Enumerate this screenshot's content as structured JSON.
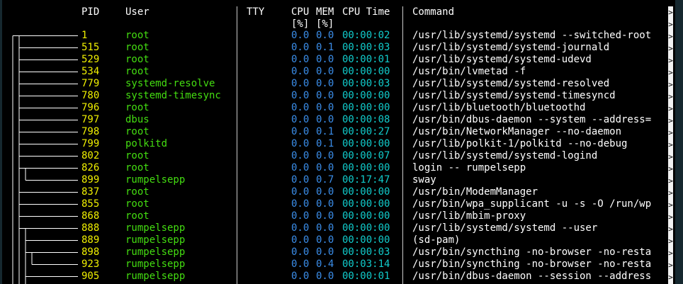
{
  "columns": {
    "pid": "PID",
    "user": "User",
    "tty": "TTY",
    "cpu": "CPU",
    "cpu_unit": "[%]",
    "mem": "MEM",
    "mem_unit": "[%]",
    "cpu_time": "CPU Time",
    "command": "Command"
  },
  "overflow_marker": ">",
  "processes": [
    {
      "pid": "1",
      "user": "root",
      "cpu": "0.0",
      "mem": "0.0",
      "time": "00:00:02",
      "command": "/usr/lib/systemd/systemd --switched-root",
      "depth": 0
    },
    {
      "pid": "515",
      "user": "root",
      "cpu": "0.0",
      "mem": "0.1",
      "time": "00:00:03",
      "command": "/usr/lib/systemd/systemd-journald",
      "depth": 1
    },
    {
      "pid": "529",
      "user": "root",
      "cpu": "0.0",
      "mem": "0.0",
      "time": "00:00:01",
      "command": "/usr/lib/systemd/systemd-udevd",
      "depth": 1
    },
    {
      "pid": "534",
      "user": "root",
      "cpu": "0.0",
      "mem": "0.0",
      "time": "00:00:00",
      "command": "/usr/bin/lvmetad -f",
      "depth": 1
    },
    {
      "pid": "779",
      "user": "systemd-resolve",
      "cpu": "0.0",
      "mem": "0.0",
      "time": "00:00:03",
      "command": "/usr/lib/systemd/systemd-resolved",
      "depth": 1
    },
    {
      "pid": "780",
      "user": "systemd-timesync",
      "cpu": "0.0",
      "mem": "0.0",
      "time": "00:00:00",
      "command": "/usr/lib/systemd/systemd-timesyncd",
      "depth": 1
    },
    {
      "pid": "796",
      "user": "root",
      "cpu": "0.0",
      "mem": "0.0",
      "time": "00:00:00",
      "command": "/usr/lib/bluetooth/bluetoothd",
      "depth": 1
    },
    {
      "pid": "797",
      "user": "dbus",
      "cpu": "0.0",
      "mem": "0.0",
      "time": "00:00:08",
      "command": "/usr/bin/dbus-daemon --system --address=",
      "depth": 1
    },
    {
      "pid": "798",
      "user": "root",
      "cpu": "0.0",
      "mem": "0.1",
      "time": "00:00:27",
      "command": "/usr/bin/NetworkManager --no-daemon",
      "depth": 1
    },
    {
      "pid": "799",
      "user": "polkitd",
      "cpu": "0.0",
      "mem": "0.1",
      "time": "00:00:00",
      "command": "/usr/lib/polkit-1/polkitd --no-debug",
      "depth": 1
    },
    {
      "pid": "802",
      "user": "root",
      "cpu": "0.0",
      "mem": "0.0",
      "time": "00:00:07",
      "command": "/usr/lib/systemd/systemd-logind",
      "depth": 1
    },
    {
      "pid": "826",
      "user": "root",
      "cpu": "0.0",
      "mem": "0.0",
      "time": "00:00:00",
      "command": "login -- rumpelsepp",
      "depth": 1
    },
    {
      "pid": "899",
      "user": "rumpelsepp",
      "cpu": "0.0",
      "mem": "0.7",
      "time": "00:17:47",
      "command": "sway",
      "depth": 2
    },
    {
      "pid": "837",
      "user": "root",
      "cpu": "0.0",
      "mem": "0.0",
      "time": "00:00:00",
      "command": "/usr/bin/ModemManager",
      "depth": 1
    },
    {
      "pid": "855",
      "user": "root",
      "cpu": "0.0",
      "mem": "0.0",
      "time": "00:00:00",
      "command": "/usr/bin/wpa_supplicant -u -s -O /run/wp",
      "depth": 1
    },
    {
      "pid": "868",
      "user": "root",
      "cpu": "0.0",
      "mem": "0.0",
      "time": "00:00:00",
      "command": "/usr/lib/mbim-proxy",
      "depth": 1
    },
    {
      "pid": "888",
      "user": "rumpelsepp",
      "cpu": "0.0",
      "mem": "0.0",
      "time": "00:00:00",
      "command": "/usr/lib/systemd/systemd --user",
      "depth": 1
    },
    {
      "pid": "889",
      "user": "rumpelsepp",
      "cpu": "0.0",
      "mem": "0.0",
      "time": "00:00:00",
      "command": "(sd-pam)",
      "depth": 2
    },
    {
      "pid": "898",
      "user": "rumpelsepp",
      "cpu": "0.0",
      "mem": "0.0",
      "time": "00:00:03",
      "command": "/usr/bin/syncthing -no-browser -no-resta",
      "depth": 2
    },
    {
      "pid": "923",
      "user": "rumpelsepp",
      "cpu": "0.0",
      "mem": "0.4",
      "time": "00:03:14",
      "command": "/usr/bin/syncthing -no-browser -no-resta",
      "depth": 3
    },
    {
      "pid": "905",
      "user": "rumpelsepp",
      "cpu": "0.0",
      "mem": "0.0",
      "time": "00:00:01",
      "command": "/usr/bin/dbus-daemon --session --address",
      "depth": 2
    }
  ]
}
